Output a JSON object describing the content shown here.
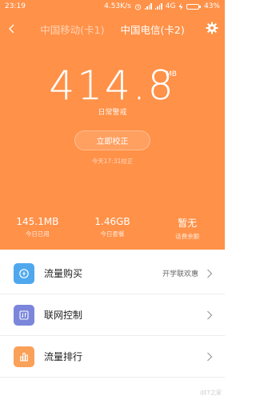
{
  "status_bar": {
    "time": "23:19",
    "net_speed": "4.53K/s",
    "network": "4G",
    "battery": "43%"
  },
  "tabs": [
    {
      "label": "中国移动(卡1)"
    },
    {
      "label": "中国电信(卡2)"
    }
  ],
  "usage": {
    "value": "414.8",
    "unit": "MB",
    "subtitle": "日常警戒"
  },
  "calibrate": {
    "button_label": "立即校正",
    "note": "今天17:31校正"
  },
  "stats": [
    {
      "value": "145.1MB",
      "label": "今日已用"
    },
    {
      "value": "1.46GB",
      "label": "今日套餐"
    },
    {
      "value": "暂无",
      "label": "话费余额"
    }
  ],
  "menu": [
    {
      "title": "流量购买",
      "extra": "开学联欢惠",
      "icon": "purchase-icon",
      "color": "#4fa8ee"
    },
    {
      "title": "联网控制",
      "extra": "",
      "icon": "network-control-icon",
      "color": "#7b86db"
    },
    {
      "title": "流量排行",
      "extra": "",
      "icon": "bar-chart-icon",
      "color": "#f9a059"
    }
  ],
  "watermark": "@IT之家"
}
